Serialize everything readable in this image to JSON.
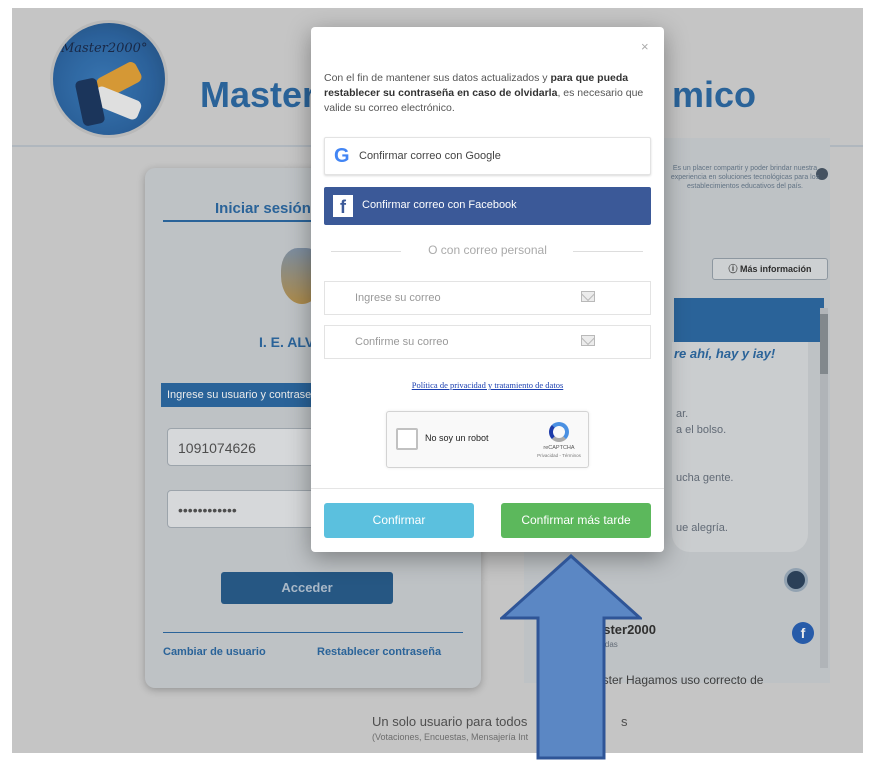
{
  "background": {
    "logo_text": "Master2000°",
    "brand_left": "Master",
    "brand_right": "mico",
    "login": {
      "title": "Iniciar sesión",
      "school": "I. E. ALV",
      "hint": "Ingrese su usuario y contraseña",
      "username_value": "1091074626",
      "password_value": "••••••••••••",
      "submit_label": "Acceder",
      "change_user_label": "Cambiar de usuario",
      "reset_password_label": "Restablecer contraseña"
    },
    "social": {
      "tiny_text": "Es un placer compartir y poder brindar nuestra experiencia en soluciones tecnológicas para los establecimientos educativos del país.",
      "more_info_label": "Más información",
      "bubble_text": "re ahí, hay y iay!",
      "lines": [
        "ar.",
        "a el bolso.",
        "ucha gente.",
        "ue alegría."
      ],
      "page_name": "aster2000",
      "page_sub": "nadas",
      "post_text": "aster Hagamos uso correcto de"
    },
    "footer_line1": "Un solo usuario para todos",
    "footer_line1_end": "s",
    "footer_line2": "(Votaciones, Encuestas, Mensajería Int"
  },
  "modal": {
    "close_label": "×",
    "intro_part1": "Con el fin de mantener sus datos actualizados y ",
    "intro_bold": "para que pueda restablecer su contraseña en caso de olvidarla",
    "intro_part2": ", es necesario que valide su correo electrónico.",
    "google_label": "Confirmar correo con Google",
    "facebook_label": "Confirmar correo con Facebook",
    "divider_text": "O con correo personal",
    "email_placeholder": "Ingrese su correo",
    "email_confirm_placeholder": "Confirme su correo",
    "privacy_link": "Política de privacidad y tratamiento de datos",
    "captcha_label": "No soy un robot",
    "captcha_brand": "reCAPTCHA",
    "captcha_terms": "Privacidad - Términos",
    "confirm_label": "Confirmar",
    "later_label": "Confirmar más tarde"
  },
  "colors": {
    "brand_blue": "#2e6ca6",
    "facebook": "#3b5998",
    "confirm": "#5bc0de",
    "later": "#5cb85c",
    "arrow_fill": "#5b87c4",
    "arrow_stroke": "#2f5597"
  },
  "icons": [
    "google-g-icon",
    "facebook-f-icon",
    "envelope-icon",
    "close-icon",
    "recaptcha-icon",
    "globe-icon",
    "info-icon",
    "up-arrow-icon"
  ]
}
